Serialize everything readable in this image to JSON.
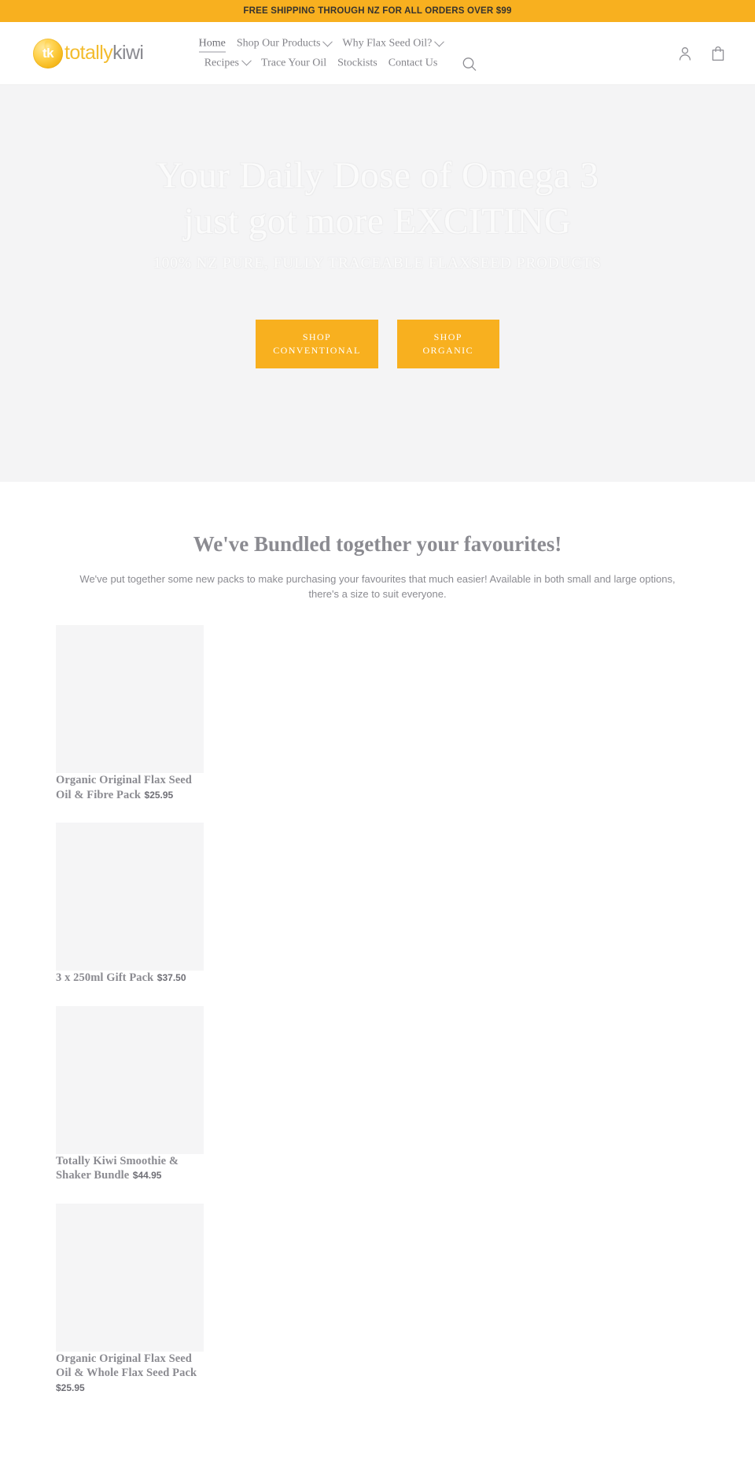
{
  "announcement": {
    "text": "FREE SHIPPING THROUGH NZ FOR ALL ORDERS OVER $99",
    "background": "#f8b01f",
    "text_color": "#36332f"
  },
  "header": {
    "logo": {
      "badge_text": "tk",
      "word_1": "totally",
      "word_2": "kiwi",
      "word_1_color": "#f3bc2e",
      "word_2_color": "#8a8a90"
    },
    "nav": [
      {
        "label": "Home",
        "has_dropdown": false,
        "active": true
      },
      {
        "label": "Shop Our Products",
        "has_dropdown": true,
        "active": false
      },
      {
        "label": "Why Flax Seed Oil?",
        "has_dropdown": true,
        "active": false
      },
      {
        "label": "Recipes",
        "has_dropdown": true,
        "active": false
      },
      {
        "label": "Trace Your Oil",
        "has_dropdown": false,
        "active": false
      },
      {
        "label": "Stockists",
        "has_dropdown": false,
        "active": false
      },
      {
        "label": "Contact Us",
        "has_dropdown": false,
        "active": false
      }
    ],
    "icons": {
      "search": "search-icon",
      "account": "account-icon",
      "cart": "cart-icon"
    }
  },
  "hero": {
    "title_line_1": "Your Daily Dose of Omega 3",
    "title_line_2": "just got more EXCITING",
    "subtitle": "100% NZ PURE, FULLY TRACEABLE FLAXSEED PRODUCTS",
    "background": "#f4f4f5",
    "buttons": [
      {
        "line_1": "SHOP",
        "line_2": "CONVENTIONAL",
        "color": "#f8b01f"
      },
      {
        "line_1": "SHOP",
        "line_2": "ORGANIC",
        "color": "#f8b01f"
      }
    ]
  },
  "bundles": {
    "title": "We've Bundled together your favourites!",
    "description": "We've put together some new packs to make purchasing your favourites that much easier! Available in both small and large options, there's a size to suit everyone.",
    "products": [
      {
        "title": "Organic Original Flax Seed Oil & Fibre Pack",
        "price": "$25.95"
      },
      {
        "title": "3 x 250ml Gift Pack",
        "price": "$37.50"
      },
      {
        "title": "Totally Kiwi Smoothie & Shaker Bundle",
        "price": "$44.95"
      },
      {
        "title": "Organic Original Flax Seed Oil & Whole Flax Seed Pack",
        "price": "$25.95"
      }
    ]
  }
}
